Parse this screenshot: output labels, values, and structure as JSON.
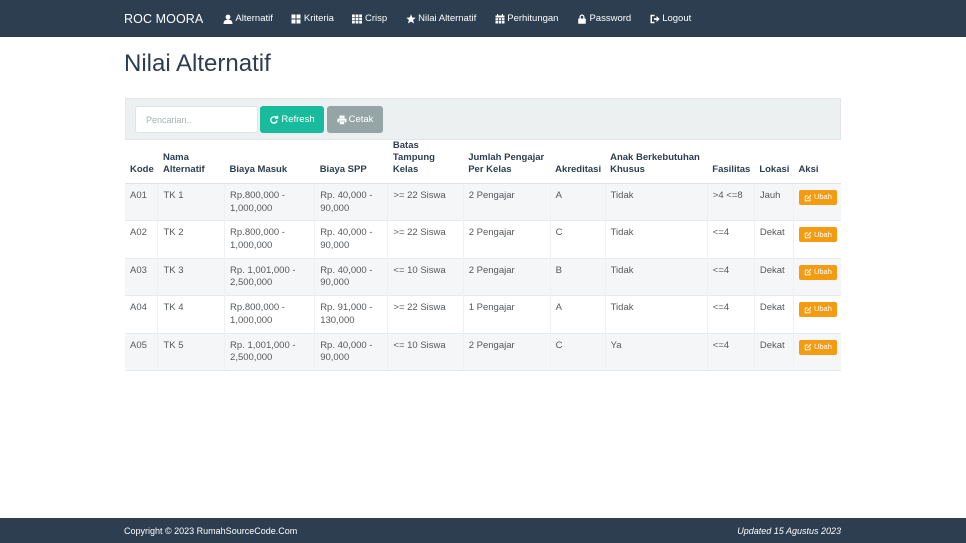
{
  "navbar": {
    "brand": "ROC MOORA",
    "items": [
      {
        "label": "Alternatif",
        "icon": "user-icon"
      },
      {
        "label": "Kriteria",
        "icon": "th-large-icon"
      },
      {
        "label": "Crisp",
        "icon": "th-icon"
      },
      {
        "label": "Nilai Alternatif",
        "icon": "star-icon"
      },
      {
        "label": "Perhitungan",
        "icon": "calendar-icon"
      },
      {
        "label": "Password",
        "icon": "lock-icon"
      },
      {
        "label": "Logout",
        "icon": "logout-icon"
      }
    ]
  },
  "page": {
    "title": "Nilai Alternatif"
  },
  "toolbar": {
    "search_placeholder": "Pencarian..",
    "refresh_label": "Refresh",
    "print_label": "Cetak"
  },
  "table": {
    "headers": [
      "Kode",
      "Nama Alternatif",
      "Biaya Masuk",
      "Biaya SPP",
      "Batas Tampung Kelas",
      "Jumlah Pengajar Per Kelas",
      "Akreditasi",
      "Anak Berkebutuhan Khusus",
      "Fasilitas",
      "Lokasi",
      "Aksi"
    ],
    "edit_label": "Ubah",
    "rows": [
      [
        "A01",
        "TK 1",
        "Rp.800,000 - 1,000,000",
        "Rp. 40,000 - 90,000",
        ">= 22 Siswa",
        "2 Pengajar",
        "A",
        "Tidak",
        ">4 <=8",
        "Jauh"
      ],
      [
        "A02",
        "TK 2",
        "Rp.800,000 - 1,000,000",
        "Rp. 40,000 - 90,000",
        ">= 22 Siswa",
        "2 Pengajar",
        "C",
        "Tidak",
        "<=4",
        "Dekat"
      ],
      [
        "A03",
        "TK 3",
        "Rp. 1,001,000 - 2,500,000",
        "Rp. 40,000 - 90,000",
        "<= 10 Siswa",
        "2 Pengajar",
        "B",
        "Tidak",
        "<=4",
        "Dekat"
      ],
      [
        "A04",
        "TK 4",
        "Rp.800,000 - 1,000,000",
        "Rp. 91,000 - 130,000",
        ">= 22 Siswa",
        "1 Pengajar",
        "A",
        "Tidak",
        "<=4",
        "Dekat"
      ],
      [
        "A05",
        "TK 5",
        "Rp. 1,001,000 - 2,500,000",
        "Rp. 40,000 - 90,000",
        "<= 10 Siswa",
        "2 Pengajar",
        "C",
        "Ya",
        "<=4",
        "Dekat"
      ]
    ]
  },
  "footer": {
    "copyright": "Copyright © 2023 RumahSourceCode.Com",
    "updated": "Updated 15 Agustus 2023"
  },
  "colors": {
    "navbar": "#2c3e50",
    "refresh": "#18bc9c",
    "print": "#95a5a6",
    "edit": "#f39c12"
  }
}
